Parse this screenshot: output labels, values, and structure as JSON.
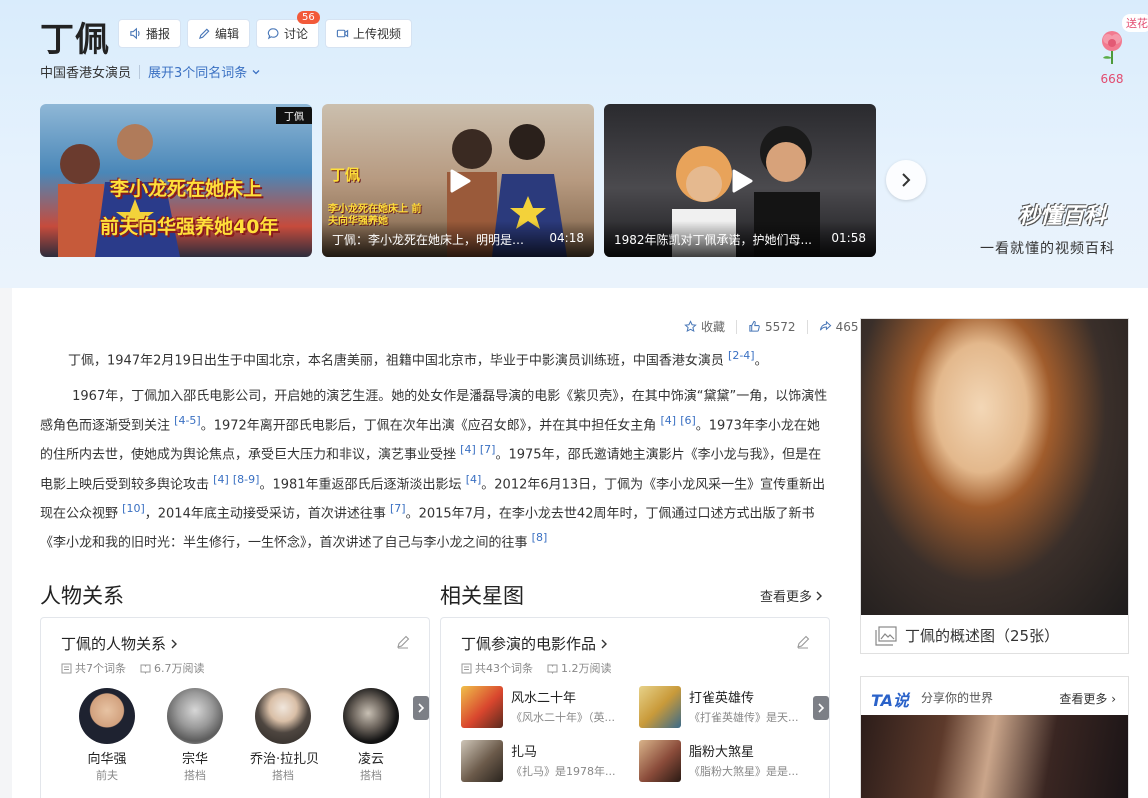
{
  "header": {
    "title": "丁佩",
    "buttons": [
      {
        "label": "播报",
        "icon": "speaker-icon"
      },
      {
        "label": "编辑",
        "icon": "pencil-icon"
      },
      {
        "label": "讨论",
        "icon": "chat-icon",
        "badge": "56"
      },
      {
        "label": "上传视频",
        "icon": "video-icon"
      }
    ],
    "subtitle": "中国香港女演员",
    "homonym_link": "展开3个同名词条",
    "flower_tag": "送花",
    "flower_count": "668"
  },
  "videos": [
    {
      "tag": "丁佩",
      "caption_top": "李小龙死在她床上",
      "caption_bottom": "前夫向华强养她40年"
    },
    {
      "title": "丁佩：李小龙死在她床上，明明是向...",
      "duration": "04:18",
      "overlay_name": "丁佩",
      "overlay_text": "李小龙死在她床上 前夫向华强养她"
    },
    {
      "title": "1982年陈凯对丁佩承诺，护她们母...",
      "duration": "01:58"
    }
  ],
  "brand": {
    "logo": "秒懂百科",
    "slogan": "一看就懂的视频百科"
  },
  "actions": {
    "favorite": "收藏",
    "likes": "5572",
    "shares": "465"
  },
  "intro": {
    "p1": "丁佩，1947年2月19日出生于中国北京，本名唐美丽，祖籍中国北京市，毕业于中影演员训练班，中国香港女演员",
    "p1_ref": "[2-4]",
    "p2": [
      {
        "text": "1967年，丁佩加入邵氏电影公司，开启她的演艺生涯。她的处女作是潘磊导演的电影《紫贝壳》，在其中饰演“黛黛”一角，以饰演性感角色而逐渐受到关注"
      },
      {
        "ref": "[4-5]"
      },
      {
        "text": "。1972年离开邵氏电影后，丁佩在次年出演《应召女郎》，并在其中担任女主角"
      },
      {
        "ref": "[4]"
      },
      {
        "ref": "[6]"
      },
      {
        "text": "。1973年李小龙在她的住所内去世，使她成为舆论焦点，承受巨大压力和非议，演艺事业受挫"
      },
      {
        "ref": "[4]"
      },
      {
        "ref": "[7]"
      },
      {
        "text": "。1975年，邵氏邀请她主演影片《李小龙与我》，但是在电影上映后受到较多舆论攻击"
      },
      {
        "ref": "[4]"
      },
      {
        "ref": "[8-9]"
      },
      {
        "text": "。1981年重返邵氏后逐渐淡出影坛"
      },
      {
        "ref": "[4]"
      },
      {
        "text": "。2012年6月13日，丁佩为《李小龙风采一生》宣传重新出现在公众视野"
      },
      {
        "ref": "[10]"
      },
      {
        "text": "，2014年底主动接受采访，首次讲述往事"
      },
      {
        "ref": "[7]"
      },
      {
        "text": "。2015年7月，在李小龙去世42周年时，丁佩通过口述方式出版了新书《李小龙和我的旧时光：半生修行，一生怀念》，首次讲述了自己与李小龙之间的往事"
      },
      {
        "ref": "[8]"
      }
    ]
  },
  "relations": {
    "section_title": "人物关系",
    "box_title": "丁佩的人物关系",
    "entries": "共7个词条",
    "reads": "6.7万阅读",
    "people": [
      {
        "name": "向华强",
        "role": "前夫",
        "color": "#3b3d46"
      },
      {
        "name": "宗华",
        "role": "搭档",
        "color": "#8c8c8c"
      },
      {
        "name": "乔治·拉扎贝",
        "role": "搭档",
        "color": "#5a4f48"
      },
      {
        "name": "凌云",
        "role": "搭档",
        "color": "#2a2a2a"
      }
    ]
  },
  "stars": {
    "section_title": "相关星图",
    "more": "查看更多",
    "box_title": "丁佩参演的电影作品",
    "entries": "共43个词条",
    "reads": "1.2万阅读",
    "films": [
      {
        "title": "风水二十年",
        "desc": "《风水二十年》（英...",
        "color": "#d9462e"
      },
      {
        "title": "打雀英雄传",
        "desc": "《打雀英雄传》是天...",
        "color": "#c99a3a"
      },
      {
        "title": "扎马",
        "desc": "《扎马》是1978年...",
        "color": "#6b5a4a"
      },
      {
        "title": "脂粉大煞星",
        "desc": "《脂粉大煞星》是是...",
        "color": "#8a4b3a"
      }
    ]
  },
  "summary_photo": {
    "caption": "丁佩的概述图（25张）"
  },
  "ta": {
    "logo": "TA说",
    "slogan": "分享你的世界",
    "more": "查看更多"
  }
}
